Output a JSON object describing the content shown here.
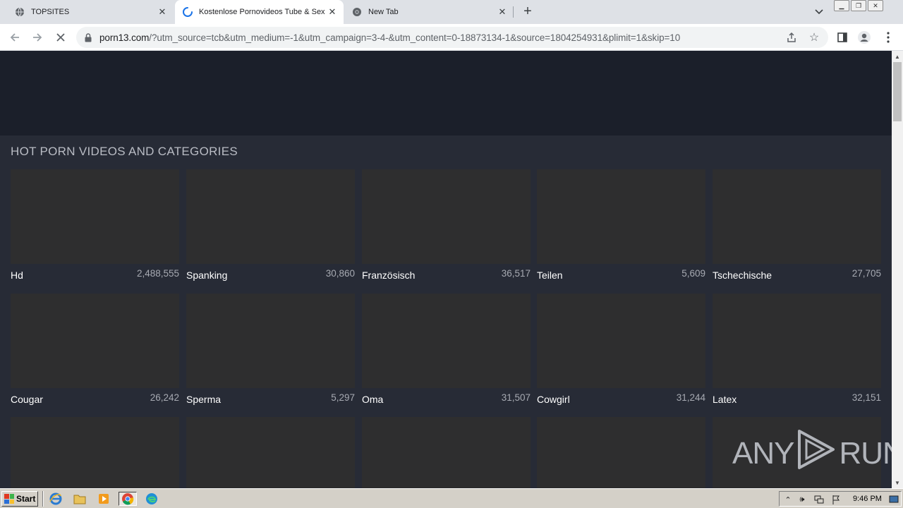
{
  "browser": {
    "tabs": [
      {
        "title": "TOPSITES",
        "icon": "globe-icon",
        "active": false
      },
      {
        "title": "Kostenlose Pornovideos Tube & Sex",
        "icon": "loading-spinner-icon",
        "active": true
      },
      {
        "title": "New Tab",
        "icon": "chrome-icon",
        "active": false
      }
    ],
    "url_domain": "porn13.com",
    "url_rest": "/?utm_source=tcb&utm_medium=-1&utm_campaign=3-4-&utm_content=0-18873134-1&source=1804254931&plimit=1&skip=10"
  },
  "page": {
    "section_title": "HOT PORN VIDEOS AND CATEGORIES",
    "categories": [
      {
        "name": "Hd",
        "count": "2,488,555"
      },
      {
        "name": "Spanking",
        "count": "30,860"
      },
      {
        "name": "Französisch",
        "count": "36,517"
      },
      {
        "name": "Teilen",
        "count": "5,609"
      },
      {
        "name": "Tschechische",
        "count": "27,705"
      },
      {
        "name": "Cougar",
        "count": "26,242"
      },
      {
        "name": "Sperma",
        "count": "5,297"
      },
      {
        "name": "Oma",
        "count": "31,507"
      },
      {
        "name": "Cowgirl",
        "count": "31,244"
      },
      {
        "name": "Latex",
        "count": "32,151"
      }
    ],
    "watermark_left": "ANY",
    "watermark_right": "RUN"
  },
  "taskbar": {
    "start_label": "Start",
    "clock": "9:46 PM"
  },
  "colors": {
    "page_bg": "#272b36",
    "header_bg": "#1b1f2a",
    "thumb_bg": "#2e2e2f"
  }
}
